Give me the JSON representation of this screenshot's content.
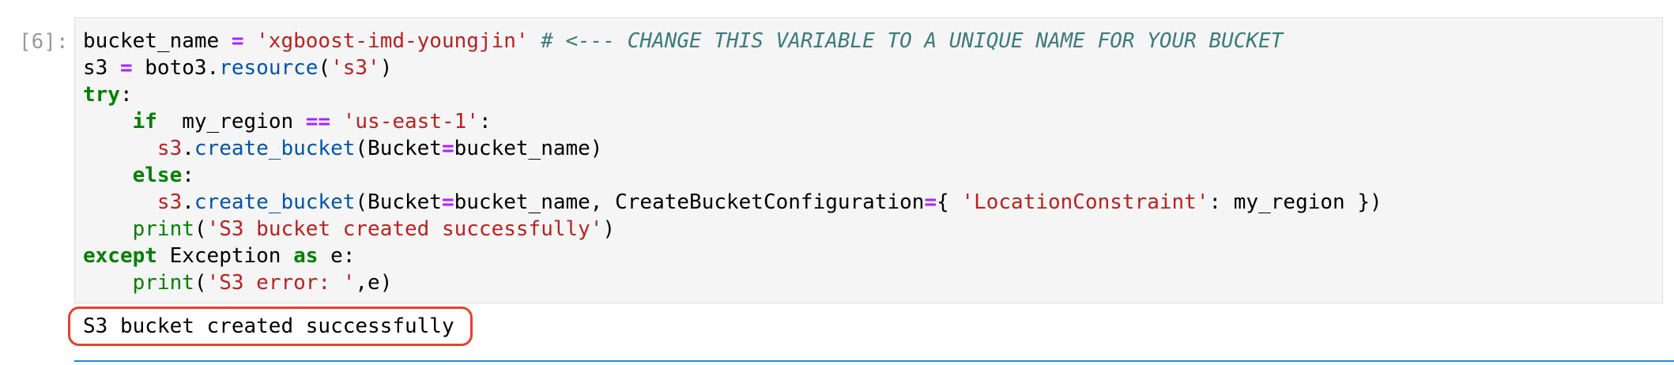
{
  "cell": {
    "prompt": "[6]:",
    "code_lines": [
      [
        {
          "t": "bucket_name ",
          "c": "plain"
        },
        {
          "t": "=",
          "c": "op"
        },
        {
          "t": " ",
          "c": "plain"
        },
        {
          "t": "'xgboost-imd-youngjin'",
          "c": "str"
        },
        {
          "t": " ",
          "c": "plain"
        },
        {
          "t": "# <--- CHANGE THIS VARIABLE TO A UNIQUE NAME FOR YOUR BUCKET",
          "c": "cmt"
        }
      ],
      [
        {
          "t": "s3 ",
          "c": "plain"
        },
        {
          "t": "=",
          "c": "op"
        },
        {
          "t": " boto3",
          "c": "plain"
        },
        {
          "t": ".",
          "c": "plain"
        },
        {
          "t": "resource",
          "c": "fn"
        },
        {
          "t": "(",
          "c": "plain"
        },
        {
          "t": "'s3'",
          "c": "str"
        },
        {
          "t": ")",
          "c": "plain"
        }
      ],
      [
        {
          "t": "try",
          "c": "kw"
        },
        {
          "t": ":",
          "c": "plain"
        }
      ],
      [
        {
          "t": "    ",
          "c": "plain"
        },
        {
          "t": "if",
          "c": "kw"
        },
        {
          "t": "  my_region ",
          "c": "plain"
        },
        {
          "t": "==",
          "c": "op"
        },
        {
          "t": " ",
          "c": "plain"
        },
        {
          "t": "'us-east-1'",
          "c": "str"
        },
        {
          "t": ":",
          "c": "plain"
        }
      ],
      [
        {
          "t": "      ",
          "c": "plain"
        },
        {
          "t": "s3",
          "c": "var-red"
        },
        {
          "t": ".",
          "c": "plain"
        },
        {
          "t": "create_bucket",
          "c": "fn"
        },
        {
          "t": "(Bucket",
          "c": "plain"
        },
        {
          "t": "=",
          "c": "op"
        },
        {
          "t": "bucket_name)",
          "c": "plain"
        }
      ],
      [
        {
          "t": "    ",
          "c": "plain"
        },
        {
          "t": "else",
          "c": "kw"
        },
        {
          "t": ":",
          "c": "plain"
        }
      ],
      [
        {
          "t": "      ",
          "c": "plain"
        },
        {
          "t": "s3",
          "c": "var-red"
        },
        {
          "t": ".",
          "c": "plain"
        },
        {
          "t": "create_bucket",
          "c": "fn"
        },
        {
          "t": "(Bucket",
          "c": "plain"
        },
        {
          "t": "=",
          "c": "op"
        },
        {
          "t": "bucket_name, CreateBucketConfiguration",
          "c": "plain"
        },
        {
          "t": "=",
          "c": "op"
        },
        {
          "t": "{ ",
          "c": "plain"
        },
        {
          "t": "'LocationConstraint'",
          "c": "str"
        },
        {
          "t": ": my_region })",
          "c": "plain"
        }
      ],
      [
        {
          "t": "    ",
          "c": "plain"
        },
        {
          "t": "print",
          "c": "bi"
        },
        {
          "t": "(",
          "c": "plain"
        },
        {
          "t": "'S3 bucket created successfully'",
          "c": "str"
        },
        {
          "t": ")",
          "c": "plain"
        }
      ],
      [
        {
          "t": "except",
          "c": "kw"
        },
        {
          "t": " Exception ",
          "c": "plain"
        },
        {
          "t": "as",
          "c": "kw"
        },
        {
          "t": " e:",
          "c": "plain"
        }
      ],
      [
        {
          "t": "    ",
          "c": "plain"
        },
        {
          "t": "print",
          "c": "bi"
        },
        {
          "t": "(",
          "c": "plain"
        },
        {
          "t": "'S3 error: '",
          "c": "str"
        },
        {
          "t": ",e)",
          "c": "plain"
        }
      ]
    ],
    "output": "S3 bucket created successfully"
  },
  "colors": {
    "keyword": "#008000",
    "operator": "#aa22ff",
    "string": "#ba2121",
    "comment": "#3d7b7b",
    "function": "#0055aa",
    "highlight_border": "#e8412c",
    "next_cell_border": "#1f8ad6"
  }
}
